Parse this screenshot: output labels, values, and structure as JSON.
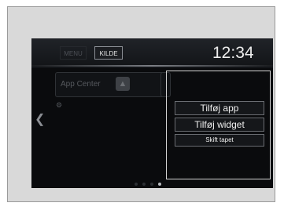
{
  "topbar": {
    "menu_label": "MENU",
    "source_label": "KILDE",
    "clock": "12:34"
  },
  "home": {
    "app_center_label": "App Center"
  },
  "context_menu": {
    "items": [
      "Tilføj app",
      "Tilføj widget",
      "Skift tapet"
    ]
  },
  "pager": {
    "dot_count": 4,
    "active_index": 2
  },
  "icons": {
    "app_center": "warning-triangle-icon",
    "left_arrow": "chevron-left-icon",
    "settings": "gear-icon"
  }
}
